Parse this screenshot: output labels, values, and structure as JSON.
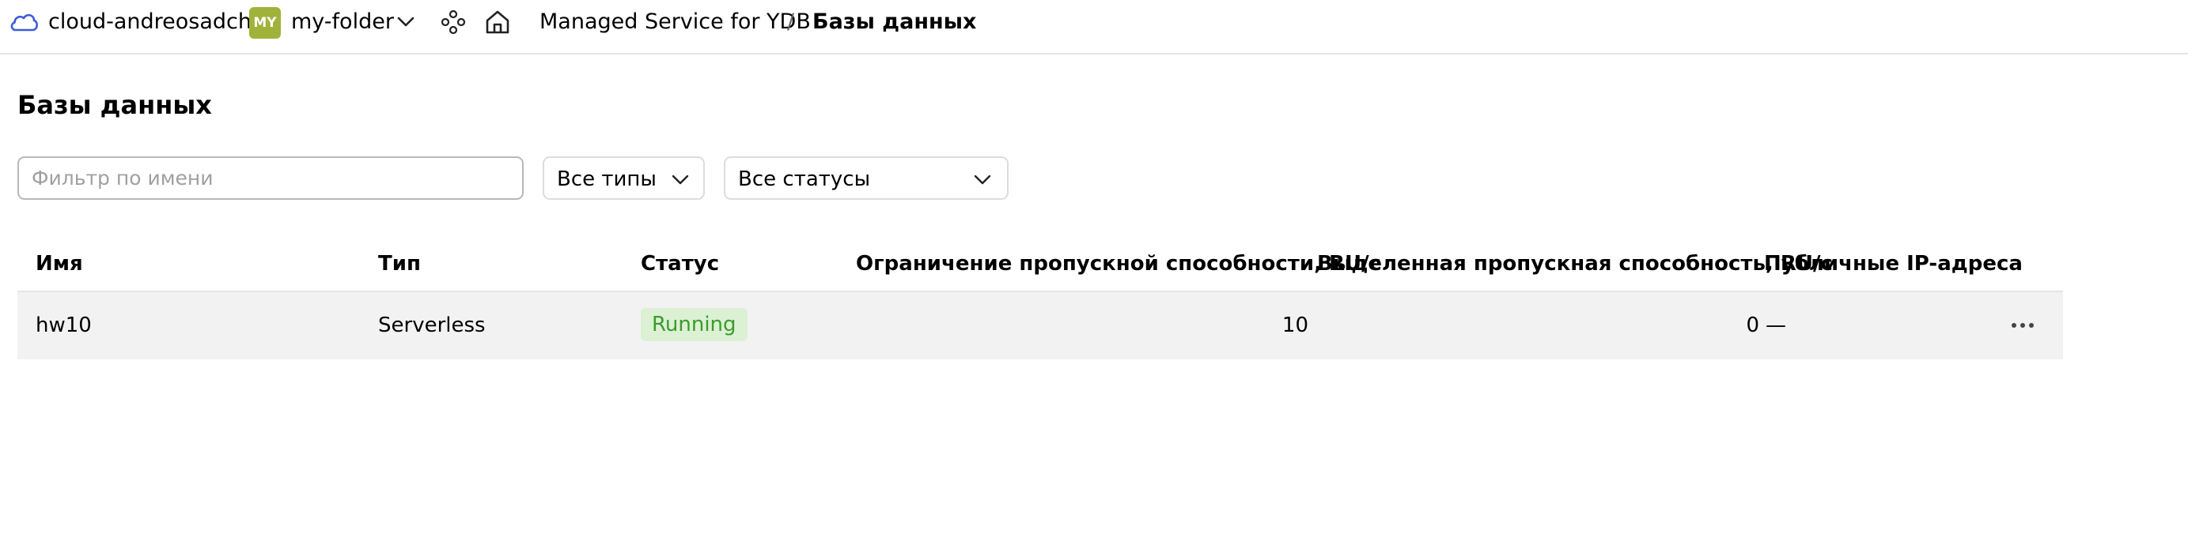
{
  "header": {
    "cloud_name": "cloud-andreosadchy",
    "folder_avatar": "MY",
    "folder_name": "my-folder",
    "breadcrumb": {
      "service": "Managed Service for YDB",
      "separator": "/",
      "current": "Базы данных"
    },
    "icons": [
      "cloud-icon",
      "chevron-down-icon",
      "services-icon",
      "home-icon"
    ],
    "colors": {
      "avatar_bg": "#a1b23a",
      "cloud_icon": "#3b5bdb"
    }
  },
  "page": {
    "title": "Базы данных",
    "filter": {
      "placeholder": "Фильтр по имени",
      "value": ""
    },
    "type_select": {
      "selected": "Все типы"
    },
    "status_select": {
      "selected": "Все статусы"
    }
  },
  "table": {
    "columns": [
      "Имя",
      "Тип",
      "Статус",
      "Ограничение пропускной способности, RU/с",
      "Выделенная пропускная способность, RU/с",
      "Публичные IP-адреса"
    ],
    "rows": [
      {
        "name": "hw10",
        "type": "Serverless",
        "status": "Running",
        "throughput_limit": "10",
        "allocated_throughput": "0",
        "public_ip": "—"
      }
    ],
    "colors": {
      "status_running_bg": "#dcf0d4",
      "status_running_text": "#3b9c2b",
      "row_bg": "#f2f2f2"
    }
  }
}
